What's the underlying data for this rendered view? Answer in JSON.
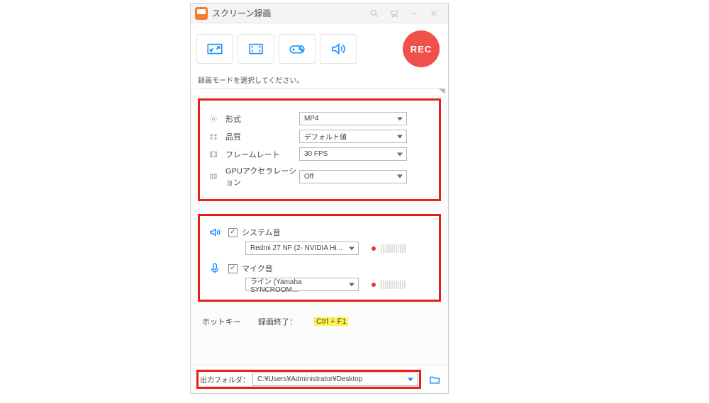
{
  "titlebar": {
    "title": "スクリーン録画"
  },
  "rec_label": "REC",
  "prompt": "録画モードを選択してください。",
  "settings": {
    "format": {
      "label": "形式",
      "value": "MP4"
    },
    "quality": {
      "label": "品質",
      "value": "デフォルト値"
    },
    "fps": {
      "label": "フレームレート",
      "value": "30 FPS"
    },
    "gpu": {
      "label": "GPUアクセラレーション",
      "value": "Off"
    }
  },
  "audio": {
    "system": {
      "label": "システム音",
      "device": "Redmi 27 NF (2- NVIDIA Hi..."
    },
    "mic": {
      "label": "マイク音",
      "device": "ライン (Yamaha SYNCROOM..."
    }
  },
  "hotkey": {
    "title": "ホットキー",
    "stop_label": "録画終了：",
    "stop_value": "Ctrl + F1"
  },
  "output": {
    "label": "出力フォルダ：",
    "path": "C:¥Users¥Administrator¥Desktop"
  }
}
